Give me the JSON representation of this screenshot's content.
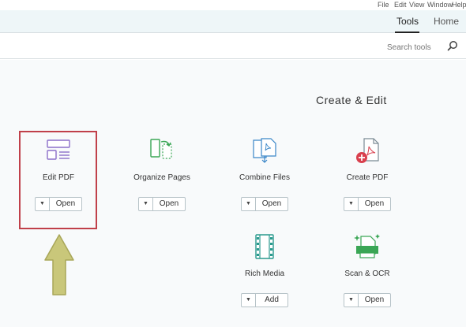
{
  "menubar": {
    "items": [
      "File",
      "Edit",
      "View",
      "Window",
      "Help"
    ]
  },
  "tabs": [
    {
      "label": "Home"
    },
    {
      "label": "Tools",
      "active": true
    }
  ],
  "search": {
    "placeholder": "Search tools"
  },
  "section": {
    "title": "Create & Edit"
  },
  "tools": [
    {
      "name": "Create PDF",
      "button": "Open",
      "icon": "create-pdf-icon"
    },
    {
      "name": "Combine Files",
      "button": "Open",
      "icon": "combine-files-icon"
    },
    {
      "name": "Organize Pages",
      "button": "Open",
      "icon": "organize-pages-icon"
    },
    {
      "name": "Edit PDF",
      "button": "Open",
      "icon": "edit-pdf-icon",
      "highlighted": true
    },
    {
      "name": "Scan & OCR",
      "button": "Open",
      "icon": "scan-ocr-icon"
    },
    {
      "name": "Rich Media",
      "button": "Add",
      "icon": "rich-media-icon"
    }
  ],
  "colors": {
    "highlight_border": "#c0404a",
    "arrow_fill": "#c9c77a",
    "icon_blue": "#3a86c8",
    "icon_green": "#3aa655",
    "icon_purple": "#8b6fc9",
    "icon_red": "#d9404e"
  }
}
